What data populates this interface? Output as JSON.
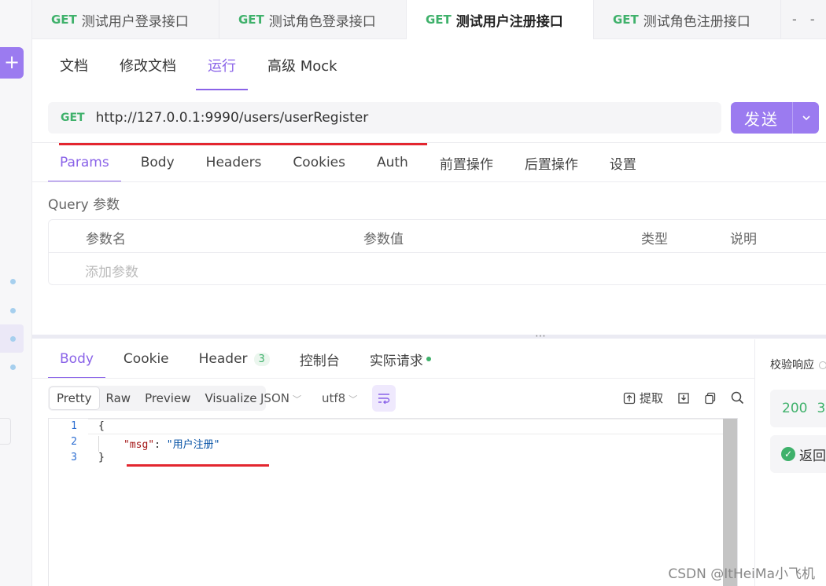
{
  "tabs": [
    {
      "method": "GET",
      "title": "测试用户登录接口",
      "active": false
    },
    {
      "method": "GET",
      "title": "测试角色登录接口",
      "active": false
    },
    {
      "method": "GET",
      "title": "测试用户注册接口",
      "active": true
    },
    {
      "method": "GET",
      "title": "测试角色注册接口",
      "active": false
    }
  ],
  "tab_more": "- -",
  "doc_nav": [
    "文档",
    "修改文档",
    "运行",
    "高级 Mock"
  ],
  "request": {
    "method": "GET",
    "url": "http://127.0.0.1:9990/users/userRegister",
    "send_label": "发送"
  },
  "request_tabs": [
    "Params",
    "Body",
    "Headers",
    "Cookies",
    "Auth",
    "前置操作",
    "后置操作",
    "设置"
  ],
  "query": {
    "label": "Query 参数",
    "columns": [
      "参数名",
      "参数值",
      "类型",
      "说明"
    ],
    "add_placeholder": "添加参数"
  },
  "response_tabs": {
    "body": "Body",
    "cookie": "Cookie",
    "header": "Header",
    "header_count": "3",
    "console": "控制台",
    "actual": "实际请求"
  },
  "view_modes": [
    "Pretty",
    "Raw",
    "Preview",
    "Visualize"
  ],
  "format": "JSON",
  "encoding": "utf8",
  "extract_label": "提取",
  "code_lines": [
    {
      "n": "1",
      "text": "{"
    },
    {
      "n": "2",
      "key": "\"msg\"",
      "sep": ": ",
      "value": "\"用户注册\""
    },
    {
      "n": "3",
      "text": "}"
    }
  ],
  "validate": {
    "title": "校验响应",
    "status": "200",
    "status_suffix": "3",
    "return_label": "返回"
  },
  "watermark": "CSDN @ItHeiMa小飞机",
  "colors": {
    "accent": "#8a63e8",
    "send_bg": "#9b7bf0",
    "get_method": "#3fb16b",
    "annotation_red": "#e3262f"
  }
}
